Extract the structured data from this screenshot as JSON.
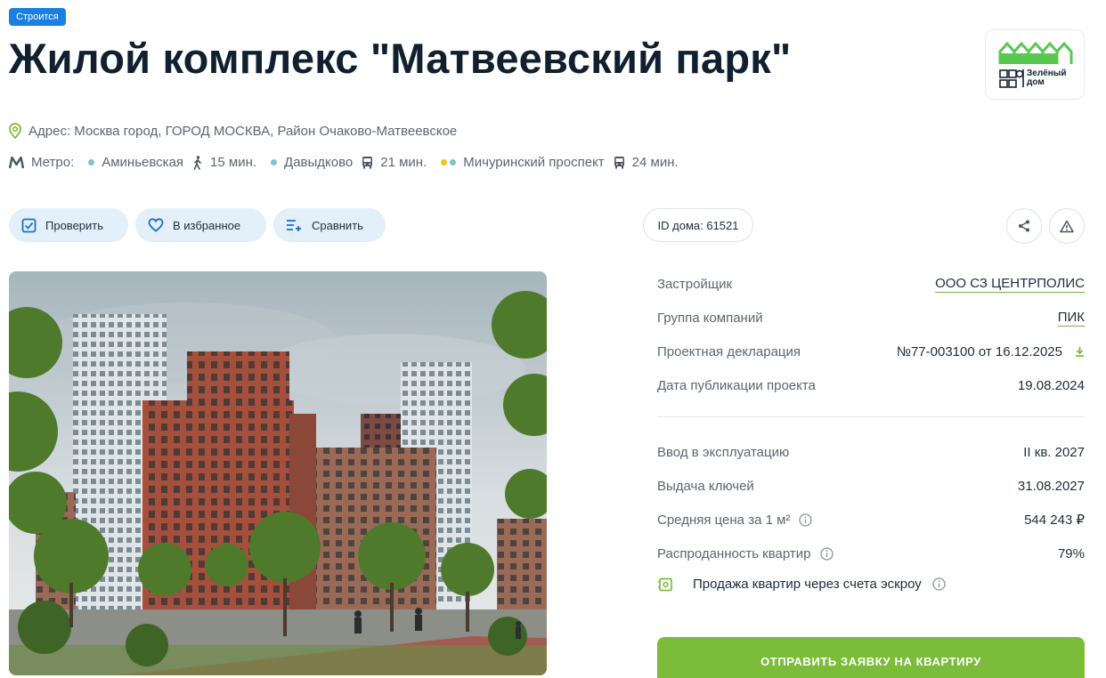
{
  "status_badge": "Строится",
  "title": "Жилой комплекс \"Матвеевский парк\"",
  "logo": {
    "name": "Зелёный дом",
    "line1": "Зелёный",
    "line2": "дом",
    "brand_color": "#57c94e"
  },
  "address": {
    "label": "Адрес:",
    "value": "Москва город, ГОРОД МОСКВА, Район Очаково-Матвеевское",
    "icon": "location-pin-icon"
  },
  "metro": {
    "label": "Метро:",
    "stations": [
      {
        "name": "Аминьевская",
        "transport": "walk",
        "time": "15 мин.",
        "line_colors": [
          "#7ec3c7"
        ]
      },
      {
        "name": "Давыдково",
        "transport": "bus",
        "time": "21 мин.",
        "line_colors": [
          "#7ec3c7"
        ]
      },
      {
        "name": "Мичуринский проспект",
        "transport": "bus",
        "time": "24 мин.",
        "line_colors": [
          "#f0c419",
          "#7ec3c7"
        ]
      }
    ]
  },
  "actions": {
    "check": "Проверить",
    "favorite": "В избранное",
    "compare": "Сравнить"
  },
  "house_id": "ID дома: 61521",
  "info": {
    "developer_label": "Застройщик",
    "developer_value": "ООО СЗ ЦЕНТРПОЛИС",
    "group_label": "Группа компаний",
    "group_value": "ПИК",
    "declaration_label": "Проектная декларация",
    "declaration_value": "№77-003100 от 16.12.2025",
    "published_label": "Дата публикации проекта",
    "published_value": "19.08.2024",
    "commission_label": "Ввод в эксплуатацию",
    "commission_value": "II кв. 2027",
    "keys_label": "Выдача ключей",
    "keys_value": "31.08.2027",
    "price_label": "Средняя цена за 1 м²",
    "price_value": "544 243 ₽",
    "sold_label": "Распроданность квартир",
    "sold_value": "79%",
    "escrow_label": "Продажа квартир через счета эскроу"
  },
  "cta_label": "ОТПРАВИТЬ ЗАЯВКУ НА КВАРТИРУ",
  "colors": {
    "accent": "#7bbc3a",
    "badge": "#1a7fe0",
    "button_bg": "#e3eff9",
    "icon_blue": "#1a6fd0"
  }
}
